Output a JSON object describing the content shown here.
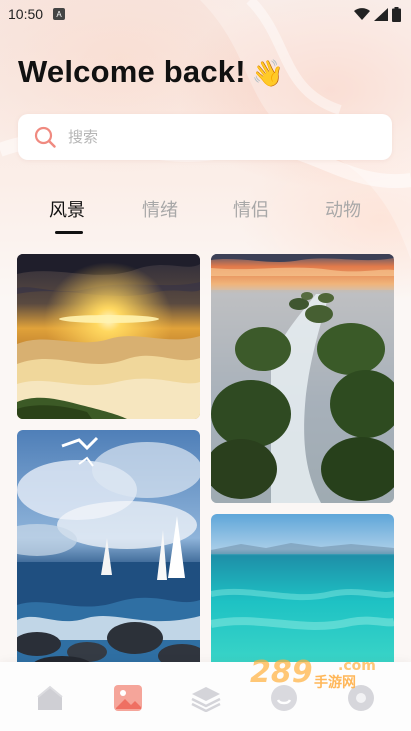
{
  "status_bar": {
    "time": "10:50",
    "icons": [
      "app-notification-icon",
      "wifi-icon",
      "signal-icon",
      "battery-icon"
    ]
  },
  "welcome": {
    "title": "Welcome back!",
    "emoji": "👋"
  },
  "search": {
    "placeholder": "搜索",
    "value": "",
    "icon": "search-icon"
  },
  "tabs": [
    {
      "label": "风景",
      "active": true
    },
    {
      "label": "情绪",
      "active": false
    },
    {
      "label": "情侣",
      "active": false
    },
    {
      "label": "动物",
      "active": false
    }
  ],
  "gallery": {
    "photos": [
      {
        "name": "sunset-over-clouds"
      },
      {
        "name": "rocky-coast-sunset"
      },
      {
        "name": "sailboats-on-sea"
      },
      {
        "name": "turquoise-sea"
      }
    ]
  },
  "bottom_nav": {
    "items": [
      {
        "icon": "home-icon",
        "active": false
      },
      {
        "icon": "image-icon",
        "active": true
      },
      {
        "icon": "layers-icon",
        "active": false
      },
      {
        "icon": "emoji-icon",
        "active": false
      },
      {
        "icon": "profile-icon",
        "active": false
      }
    ]
  },
  "watermark": {
    "logo_text": "289",
    "suffix": ".com",
    "site_text": "手游网"
  },
  "colors": {
    "accent": "#f08a80",
    "text_primary": "#111111",
    "text_muted": "#a8a8a8"
  }
}
